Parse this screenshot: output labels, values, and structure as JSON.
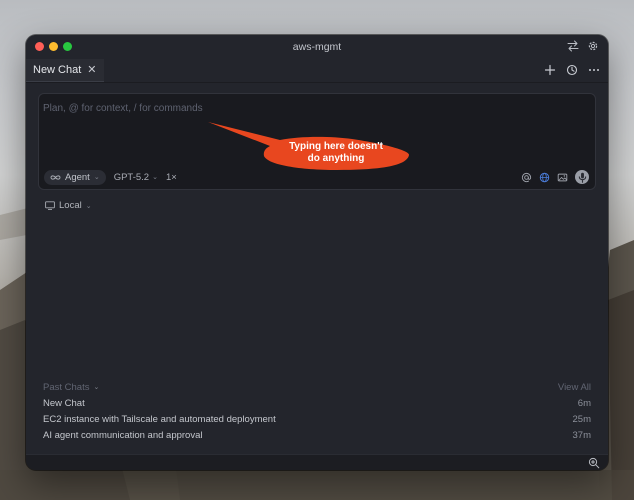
{
  "window": {
    "title": "aws-mgmt"
  },
  "tabs": [
    {
      "label": "New Chat",
      "close_glyph": "✕"
    }
  ],
  "composer": {
    "placeholder": "Plan, @ for context, / for commands",
    "mode_label": "Agent",
    "mode_icon": "infinity-icon",
    "model_label": "GPT-5.2",
    "multiplier": "1×",
    "tools": [
      "at-icon",
      "globe-icon",
      "image-icon",
      "mic-icon"
    ]
  },
  "environment": {
    "label": "Local",
    "icon": "monitor-icon"
  },
  "past_chats": {
    "title": "Past Chats",
    "view_all": "View All",
    "items": [
      {
        "title": "New Chat",
        "time": "6m"
      },
      {
        "title": "EC2 instance with Tailscale and automated deployment",
        "time": "25m"
      },
      {
        "title": "AI agent communication and approval",
        "time": "37m"
      }
    ]
  },
  "annotation": {
    "line1": "Typing here doesn't",
    "line2": "do anything",
    "color": "#e8471f"
  },
  "colors": {
    "window_bg": "#23252c",
    "composer_bg": "#191a1f",
    "accent_globe": "#4a7bd6"
  }
}
